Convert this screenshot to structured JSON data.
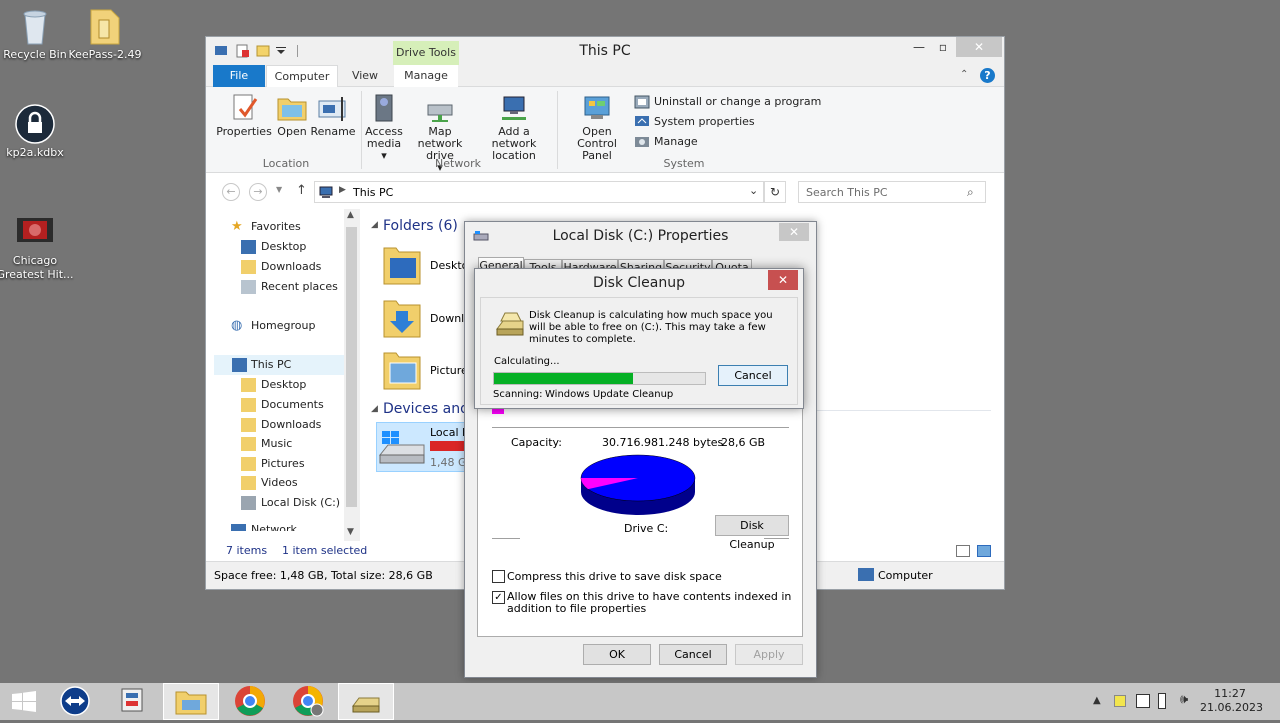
{
  "desktop": {
    "icons": [
      {
        "label": "Recycle Bin"
      },
      {
        "label": "KeePass-2.49"
      },
      {
        "label": "kp2a.kdbx"
      },
      {
        "label": "Chicago Greatest Hit..."
      }
    ]
  },
  "explorer": {
    "title": "This PC",
    "context_tab": "Drive Tools",
    "tabs": {
      "file": "File",
      "computer": "Computer",
      "view": "View",
      "manage": "Manage"
    },
    "ribbon": {
      "properties": "Properties",
      "open": "Open",
      "rename": "Rename",
      "access_media": "Access media",
      "map_network_drive": "Map network drive",
      "add_network_location": "Add a network location",
      "open_control_panel": "Open Control Panel",
      "uninstall": "Uninstall or change a program",
      "system_properties": "System properties",
      "manage": "Manage",
      "group_location": "Location",
      "group_network": "Network",
      "group_system": "System"
    },
    "address": "This PC",
    "search_placeholder": "Search This PC",
    "nav": {
      "favorites": "Favorites",
      "desktop": "Desktop",
      "downloads": "Downloads",
      "recent_places": "Recent places",
      "homegroup": "Homegroup",
      "this_pc": "This PC",
      "pc_desktop": "Desktop",
      "documents": "Documents",
      "pc_downloads": "Downloads",
      "music": "Music",
      "pictures": "Pictures",
      "videos": "Videos",
      "local_disk": "Local Disk (C:)",
      "network": "Network"
    },
    "content": {
      "folders_header": "Folders (6)",
      "folders": [
        "Deskto",
        "Downlo",
        "Picture"
      ],
      "devices_header": "Devices and d",
      "drive_name": "Local D",
      "drive_free": "1,48 GB"
    },
    "status": {
      "items": "7 items",
      "selected": "1 item selected"
    },
    "details": {
      "space": "Space free: 1,48 GB, Total size: 28,6 GB",
      "computer": "Computer"
    }
  },
  "properties_dialog": {
    "title": "Local Disk (C:) Properties",
    "tabs": [
      "General",
      "Tools",
      "Hardware",
      "Sharing",
      "Security",
      "Quota"
    ],
    "capacity_label": "Capacity:",
    "capacity_bytes": "30.716.981.248 bytes",
    "capacity_gb": "28,6 GB",
    "drive_label": "Drive C:",
    "disk_cleanup_btn": "Disk Cleanup",
    "compress_label": "Compress this drive to save disk space",
    "compress_checked": false,
    "index_label": "Allow files on this drive to have contents indexed in addition to file properties",
    "index_checked": true,
    "ok": "OK",
    "cancel": "Cancel",
    "apply": "Apply",
    "pie": {
      "used_fraction": 0.95,
      "used_color": "#0000ff",
      "free_color": "#ff00ff"
    }
  },
  "cleanup_dialog": {
    "title": "Disk Cleanup",
    "message": "Disk Cleanup is calculating how much space you will be able to free on  (C:). This may take a few minutes to complete.",
    "calculating": "Calculating...",
    "cancel": "Cancel",
    "progress": 0.66,
    "scanning_label": "Scanning:",
    "scanning_item": "Windows Update Cleanup"
  },
  "taskbar": {
    "time": "11:27",
    "date": "21.06.2023"
  },
  "colors": {
    "accent": "#1979ca",
    "progress": "#06b025"
  }
}
